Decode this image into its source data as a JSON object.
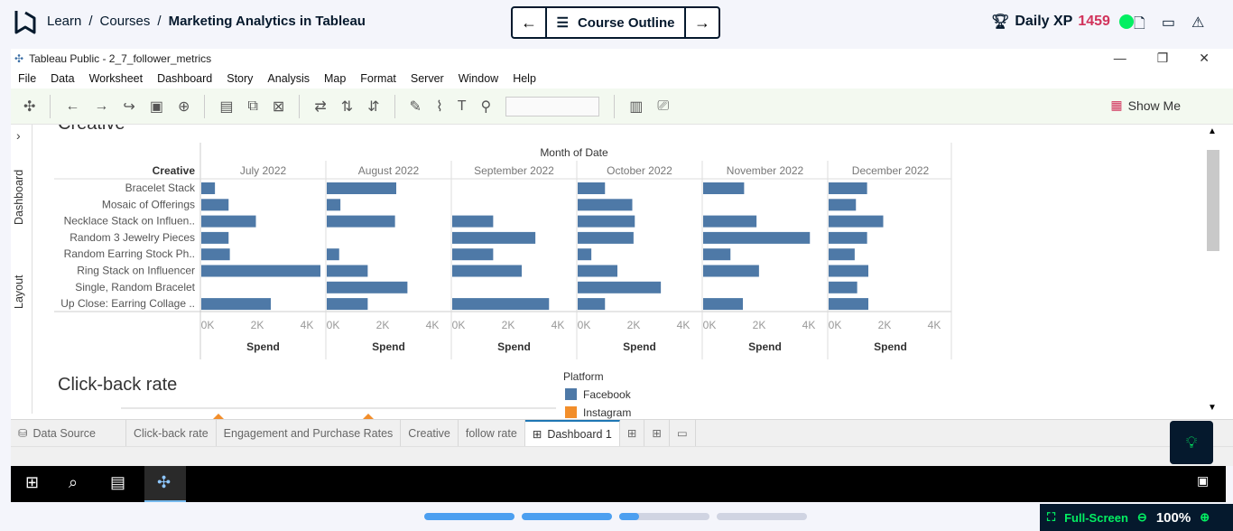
{
  "topbar": {
    "breadcrumb": [
      "Learn",
      "Courses",
      "Marketing Analytics in Tableau"
    ],
    "outline_label": "Course Outline",
    "xp_label": "Daily XP",
    "xp_value": "1459"
  },
  "window": {
    "title": "Tableau Public - 2_7_follower_metrics",
    "menu": [
      "File",
      "Data",
      "Worksheet",
      "Dashboard",
      "Story",
      "Analysis",
      "Map",
      "Format",
      "Server",
      "Window",
      "Help"
    ],
    "show_me": "Show Me",
    "side_tabs": [
      "Dashboard",
      "Layout"
    ],
    "sheet_tabs": [
      "Data Source",
      "Click-back rate",
      "Engagement and Purchase Rates",
      "Creative",
      "follow rate",
      "Dashboard 1"
    ],
    "active_tab": "Dashboard 1"
  },
  "chart_data": {
    "type": "bar",
    "title": "Creative",
    "column_header": "Month of Date",
    "row_header": "Creative",
    "xlabel": "Spend",
    "xticks": [
      "0K",
      "2K",
      "4K"
    ],
    "xlim": [
      0,
      4800
    ],
    "categories": [
      "Bracelet Stack",
      "Mosaic of Offerings",
      "Necklace Stack on Influen..",
      "Random 3 Jewelry Pieces",
      "Random Earring Stock Ph..",
      "Ring Stack on Influencer",
      "Single, Random Bracelet",
      "Up Close: Earring Collage .."
    ],
    "series": [
      {
        "name": "July 2022",
        "values": [
          550,
          1100,
          2200,
          1100,
          1150,
          4900,
          0,
          2800
        ]
      },
      {
        "name": "August 2022",
        "values": [
          2800,
          550,
          2750,
          0,
          500,
          1650,
          3250,
          1650
        ]
      },
      {
        "name": "September 2022",
        "values": [
          0,
          0,
          1650,
          3350,
          1650,
          2800,
          0,
          3900
        ]
      },
      {
        "name": "October 2022",
        "values": [
          1100,
          2200,
          2300,
          2250,
          550,
          1600,
          3350,
          1100
        ]
      },
      {
        "name": "November 2022",
        "values": [
          1650,
          0,
          2150,
          4300,
          1100,
          2250,
          0,
          1600
        ]
      },
      {
        "name": "December 2022",
        "values": [
          1550,
          1100,
          2200,
          1550,
          1050,
          1600,
          1150,
          1600
        ]
      }
    ],
    "bar_color": "#4e79a7"
  },
  "lower": {
    "title": "Click-back rate",
    "legend_title": "Platform",
    "legend": [
      {
        "name": "Facebook",
        "color": "#4e79a7"
      },
      {
        "name": "Instagram",
        "color": "#f28e2b"
      }
    ]
  },
  "footer": {
    "fullscreen_label": "Full-Screen",
    "zoom": "100%"
  }
}
